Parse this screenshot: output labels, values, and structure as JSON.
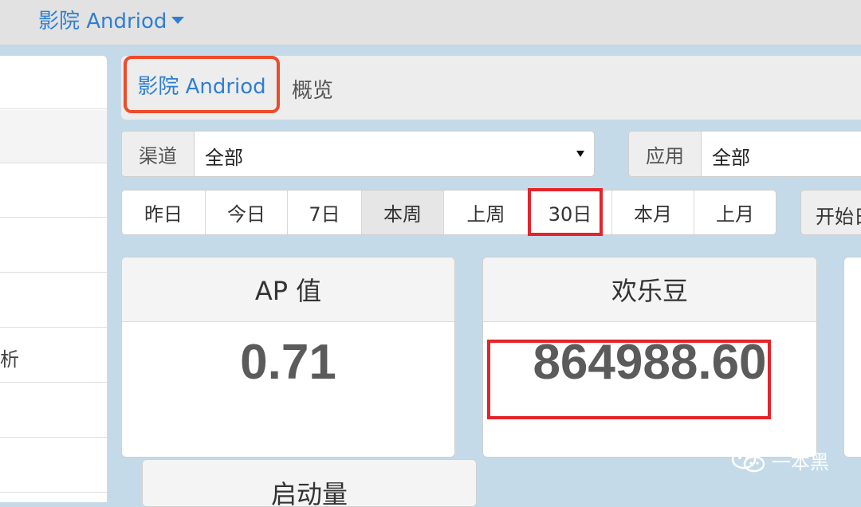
{
  "topbar": {
    "app_switcher": "影院 Andriod"
  },
  "sidebar": {
    "items": [
      "",
      "",
      "",
      "",
      "",
      "析",
      "",
      "",
      ""
    ]
  },
  "breadcrumb": {
    "app": "影院 Andriod",
    "page": "概览"
  },
  "filters": {
    "channel": {
      "label": "渠道",
      "value": "全部"
    },
    "app": {
      "label": "应用",
      "value": "全部"
    }
  },
  "date_range": {
    "buttons": [
      "昨日",
      "今日",
      "7日",
      "本周",
      "上周",
      "30日",
      "本月",
      "上月"
    ],
    "active": "本周",
    "highlighted": "30日",
    "start_label": "开始日"
  },
  "cards": [
    {
      "title": "AP 值",
      "value": "0.71"
    },
    {
      "title": "欢乐豆",
      "value": "864988.60"
    },
    {
      "title": "启动量",
      "value": ""
    }
  ],
  "watermark": {
    "text": "一本黑"
  },
  "colors": {
    "accent": "#2f7fd1",
    "highlight": "#e5232a",
    "background": "#c5dae8"
  }
}
